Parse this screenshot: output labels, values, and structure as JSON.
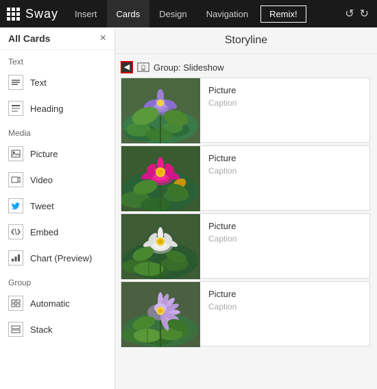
{
  "topbar": {
    "logo": "Sway",
    "tabs": [
      {
        "label": "Insert",
        "active": false
      },
      {
        "label": "Cards",
        "active": true
      },
      {
        "label": "Design",
        "active": false
      },
      {
        "label": "Navigation",
        "active": false
      }
    ],
    "remix_label": "Remix!",
    "undo_symbol": "↺",
    "redo_symbol": "↻"
  },
  "sidebar": {
    "title": "All Cards",
    "close_label": "×",
    "sections": [
      {
        "label": "Text",
        "items": [
          {
            "icon": "text",
            "label": "Text"
          },
          {
            "icon": "heading",
            "label": "Heading"
          }
        ]
      },
      {
        "label": "Media",
        "items": [
          {
            "icon": "picture",
            "label": "Picture"
          },
          {
            "icon": "video",
            "label": "Video"
          },
          {
            "icon": "tweet",
            "label": "Tweet"
          },
          {
            "icon": "embed",
            "label": "Embed"
          },
          {
            "icon": "chart",
            "label": "Chart (Preview)"
          }
        ]
      },
      {
        "label": "Group",
        "items": [
          {
            "icon": "automatic",
            "label": "Automatic"
          },
          {
            "icon": "stack",
            "label": "Stack"
          }
        ]
      }
    ]
  },
  "storyline": {
    "title": "Storyline",
    "group_label": "Group: Slideshow",
    "cards": [
      {
        "title": "Picture",
        "caption": "Caption"
      },
      {
        "title": "Picture",
        "caption": "Caption"
      },
      {
        "title": "Picture",
        "caption": "Caption"
      },
      {
        "title": "Picture",
        "caption": "Caption"
      }
    ]
  },
  "flowers": {
    "colors": [
      "#9b59b6",
      "#e91e8c",
      "#ffffff",
      "#c8a2c8"
    ]
  }
}
